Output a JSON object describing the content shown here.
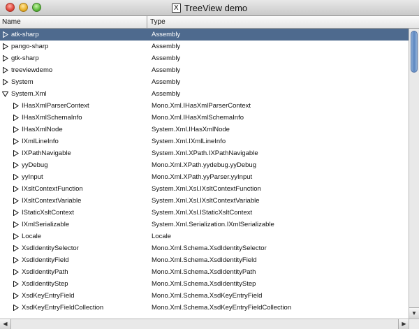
{
  "window": {
    "title": "TreeView demo",
    "title_icon": "x-icon"
  },
  "columns": [
    "Name",
    "Type"
  ],
  "rows": [
    {
      "name": "atk-sharp",
      "type": "Assembly",
      "expanded": false,
      "depth": 0,
      "selected": true
    },
    {
      "name": "pango-sharp",
      "type": "Assembly",
      "expanded": false,
      "depth": 0,
      "selected": false
    },
    {
      "name": "gtk-sharp",
      "type": "Assembly",
      "expanded": false,
      "depth": 0,
      "selected": false
    },
    {
      "name": "treeviewdemo",
      "type": "Assembly",
      "expanded": false,
      "depth": 0,
      "selected": false
    },
    {
      "name": "System",
      "type": "Assembly",
      "expanded": false,
      "depth": 0,
      "selected": false
    },
    {
      "name": "System.Xml",
      "type": "Assembly",
      "expanded": true,
      "depth": 0,
      "selected": false
    },
    {
      "name": "IHasXmlParserContext",
      "type": "Mono.Xml.IHasXmlParserContext",
      "expanded": false,
      "depth": 1,
      "selected": false
    },
    {
      "name": "IHasXmlSchemaInfo",
      "type": "Mono.Xml.IHasXmlSchemaInfo",
      "expanded": false,
      "depth": 1,
      "selected": false
    },
    {
      "name": "IHasXmlNode",
      "type": "System.Xml.IHasXmlNode",
      "expanded": false,
      "depth": 1,
      "selected": false
    },
    {
      "name": "IXmlLineInfo",
      "type": "System.Xml.IXmlLineInfo",
      "expanded": false,
      "depth": 1,
      "selected": false
    },
    {
      "name": "IXPathNavigable",
      "type": "System.Xml.XPath.IXPathNavigable",
      "expanded": false,
      "depth": 1,
      "selected": false
    },
    {
      "name": "yyDebug",
      "type": "Mono.Xml.XPath.yydebug.yyDebug",
      "expanded": false,
      "depth": 1,
      "selected": false
    },
    {
      "name": "yyInput",
      "type": "Mono.Xml.XPath.yyParser.yyInput",
      "expanded": false,
      "depth": 1,
      "selected": false
    },
    {
      "name": "IXsltContextFunction",
      "type": "System.Xml.Xsl.IXsltContextFunction",
      "expanded": false,
      "depth": 1,
      "selected": false
    },
    {
      "name": "IXsltContextVariable",
      "type": "System.Xml.Xsl.IXsltContextVariable",
      "expanded": false,
      "depth": 1,
      "selected": false
    },
    {
      "name": "IStaticXsltContext",
      "type": "System.Xml.Xsl.IStaticXsltContext",
      "expanded": false,
      "depth": 1,
      "selected": false
    },
    {
      "name": "IXmlSerializable",
      "type": "System.Xml.Serialization.IXmlSerializable",
      "expanded": false,
      "depth": 1,
      "selected": false
    },
    {
      "name": "Locale",
      "type": "Locale",
      "expanded": false,
      "depth": 1,
      "selected": false
    },
    {
      "name": "XsdIdentitySelector",
      "type": "Mono.Xml.Schema.XsdIdentitySelector",
      "expanded": false,
      "depth": 1,
      "selected": false
    },
    {
      "name": "XsdIdentityField",
      "type": "Mono.Xml.Schema.XsdIdentityField",
      "expanded": false,
      "depth": 1,
      "selected": false
    },
    {
      "name": "XsdIdentityPath",
      "type": "Mono.Xml.Schema.XsdIdentityPath",
      "expanded": false,
      "depth": 1,
      "selected": false
    },
    {
      "name": "XsdIdentityStep",
      "type": "Mono.Xml.Schema.XsdIdentityStep",
      "expanded": false,
      "depth": 1,
      "selected": false
    },
    {
      "name": "XsdKeyEntryField",
      "type": "Mono.Xml.Schema.XsdKeyEntryField",
      "expanded": false,
      "depth": 1,
      "selected": false
    },
    {
      "name": "XsdKeyEntryFieldCollection",
      "type": "Mono.Xml.Schema.XsdKeyEntryFieldCollection",
      "expanded": false,
      "depth": 1,
      "selected": false
    }
  ],
  "colors": {
    "selection": "#4e6a8e",
    "selection_text": "#ffffff"
  },
  "scrollbars": {
    "vertical_position": 0.0,
    "up_icon": "arrow-up-icon",
    "down_icon": "arrow-down-icon",
    "left_icon": "arrow-left-icon",
    "right_icon": "arrow-right-icon"
  }
}
